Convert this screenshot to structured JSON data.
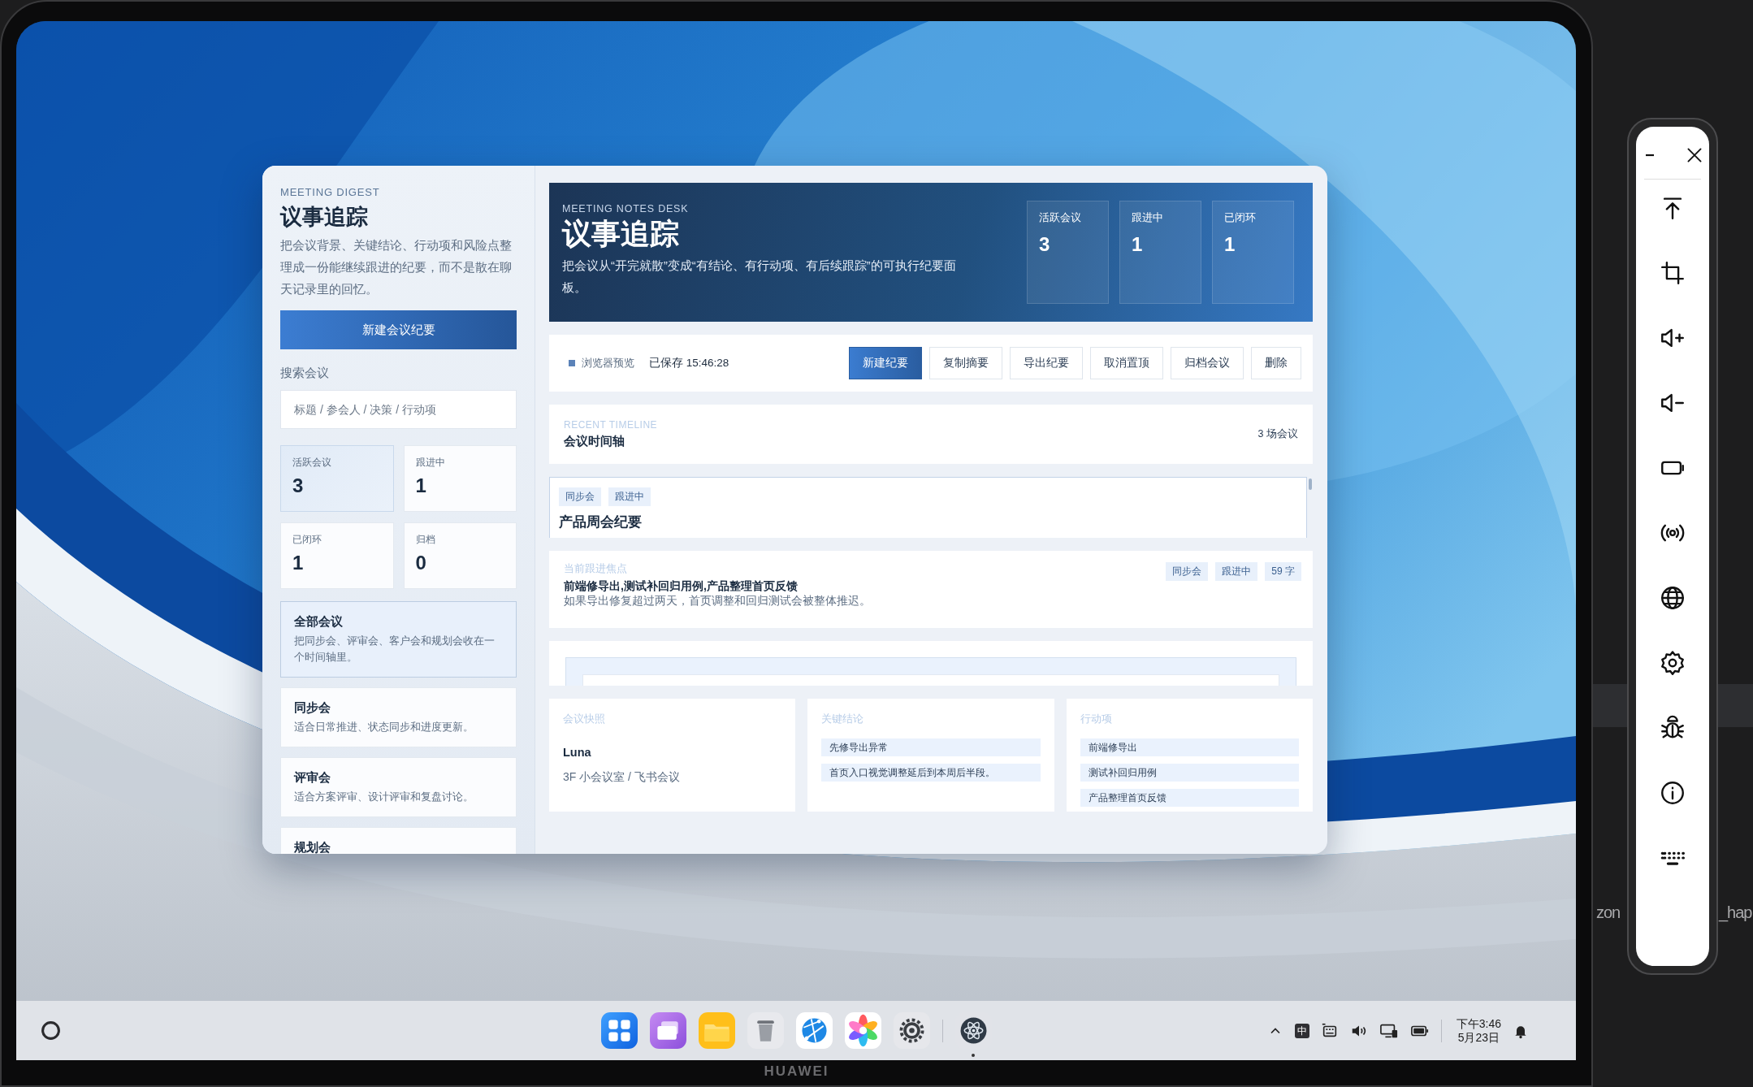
{
  "sidebar": {
    "eyebrow": "MEETING DIGEST",
    "title": "议事追踪",
    "description": "把会议背景、关键结论、行动项和风险点整理成一份能继续跟进的纪要，而不是散在聊天记录里的回忆。",
    "new_button": "新建会议纪要",
    "search_label": "搜索会议",
    "search": {
      "placeholder": "标题 / 参会人 / 决策 / 行动项"
    },
    "stats": [
      {
        "label": "活跃会议",
        "value": "3",
        "selected": true
      },
      {
        "label": "跟进中",
        "value": "1",
        "selected": false
      },
      {
        "label": "已闭环",
        "value": "1",
        "selected": false
      },
      {
        "label": "归档",
        "value": "0",
        "selected": false
      }
    ],
    "categories": [
      {
        "title": "全部会议",
        "description": "把同步会、评审会、客户会和规划会收在一个时间轴里。",
        "selected": true
      },
      {
        "title": "同步会",
        "description": "适合日常推进、状态同步和进度更新。",
        "selected": false
      },
      {
        "title": "评审会",
        "description": "适合方案评审、设计评审和复盘讨论。",
        "selected": false
      },
      {
        "title": "规划会",
        "selected": false
      }
    ]
  },
  "main": {
    "hero": {
      "eyebrow": "MEETING NOTES DESK",
      "title": "议事追踪",
      "description": "把会议从“开完就散”变成“有结论、有行动项、有后续跟踪”的可执行纪要面板。",
      "stats": [
        {
          "label": "活跃会议",
          "value": "3"
        },
        {
          "label": "跟进中",
          "value": "1"
        },
        {
          "label": "已闭环",
          "value": "1"
        }
      ]
    },
    "toolbar": {
      "status": "浏览器预览",
      "saved": "已保存 15:46:28",
      "buttons": [
        {
          "label": "新建纪要",
          "kind": "primary"
        },
        {
          "label": "复制摘要",
          "kind": "secondary"
        },
        {
          "label": "导出纪要",
          "kind": "secondary"
        },
        {
          "label": "取消置顶",
          "kind": "secondary"
        },
        {
          "label": "归档会议",
          "kind": "secondary"
        },
        {
          "label": "删除",
          "kind": "secondary"
        }
      ]
    },
    "timeline": {
      "eyebrow": "RECENT TIMELINE",
      "title": "会议时间轴",
      "count": "3 场会议",
      "items": [
        {
          "tags": [
            "同步会",
            "跟进中"
          ],
          "title": "产品周会纪要",
          "selected": true
        }
      ]
    },
    "focus": {
      "label": "当前跟进焦点",
      "title": "前端修导出,测试补回归用例,产品整理首页反馈",
      "description": "如果导出修复超过两天，首页调整和回归测试会被整体推迟。",
      "tags": [
        "同步会",
        "跟进中",
        "59 字"
      ]
    },
    "panels": [
      {
        "kind": "text",
        "title": "会议快照",
        "lines": [
          "Luna",
          "3F 小会议室 / 飞书会议"
        ]
      },
      {
        "kind": "list",
        "title": "关键结论",
        "items": [
          "先修导出异常",
          "首页入口视觉调整延后到本周后半段。"
        ]
      },
      {
        "kind": "list",
        "title": "行动项",
        "items": [
          "前端修导出",
          "测试补回归用例",
          "产品整理首页反馈"
        ]
      }
    ]
  },
  "taskbar": {
    "apps": [
      {
        "kind": "launcher",
        "running": false
      },
      {
        "kind": "multitask",
        "running": false
      },
      {
        "kind": "files",
        "running": false
      },
      {
        "kind": "trash",
        "running": false
      },
      {
        "kind": "browser",
        "running": false
      },
      {
        "kind": "gallery",
        "running": false
      },
      {
        "kind": "settings",
        "running": false
      },
      {
        "kind": "app",
        "running": true
      }
    ],
    "tray": {
      "ime": "中",
      "time": "下午3:46",
      "date": "5月23日"
    }
  },
  "device": {
    "brand": "HUAWEI"
  },
  "background_window": {
    "texts": [
      "zon",
      "_hap"
    ]
  }
}
